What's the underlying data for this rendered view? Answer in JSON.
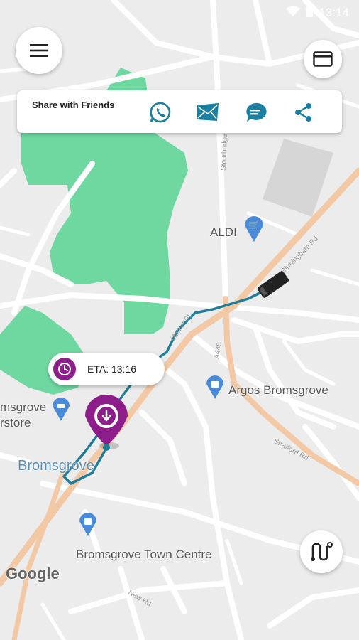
{
  "status_bar": {
    "time": "13:14",
    "wifi_icon": "wifi-icon",
    "battery_icon": "battery-icon"
  },
  "share_bar": {
    "title": "Share with Friends",
    "icons": [
      "whatsapp-icon",
      "email-icon",
      "sms-icon",
      "share-icon"
    ]
  },
  "eta": {
    "label": "ETA: 13:16"
  },
  "map": {
    "labels": {
      "aldi": "ALDI",
      "argos": "Argos Bromsgrove",
      "bromsgrove": "Bromsgrove",
      "town_centre": "Bromsgrove Town Centre",
      "superstore_line1": "msgrove",
      "superstore_line2": "rstore"
    },
    "roads": {
      "stratford": "Stratford Rd",
      "birmingham": "Birmingham Rd",
      "market": "Market St",
      "new": "New Rd",
      "a448": "A448",
      "stourbridge": "Stourbridge Rd"
    },
    "attribution": "Google"
  },
  "colors": {
    "route": "#1f7d98",
    "marker": "#8e1d8c",
    "park": "#6fd8a1",
    "main_road": "#f3c8a4",
    "accent": "#1a7fa0"
  }
}
